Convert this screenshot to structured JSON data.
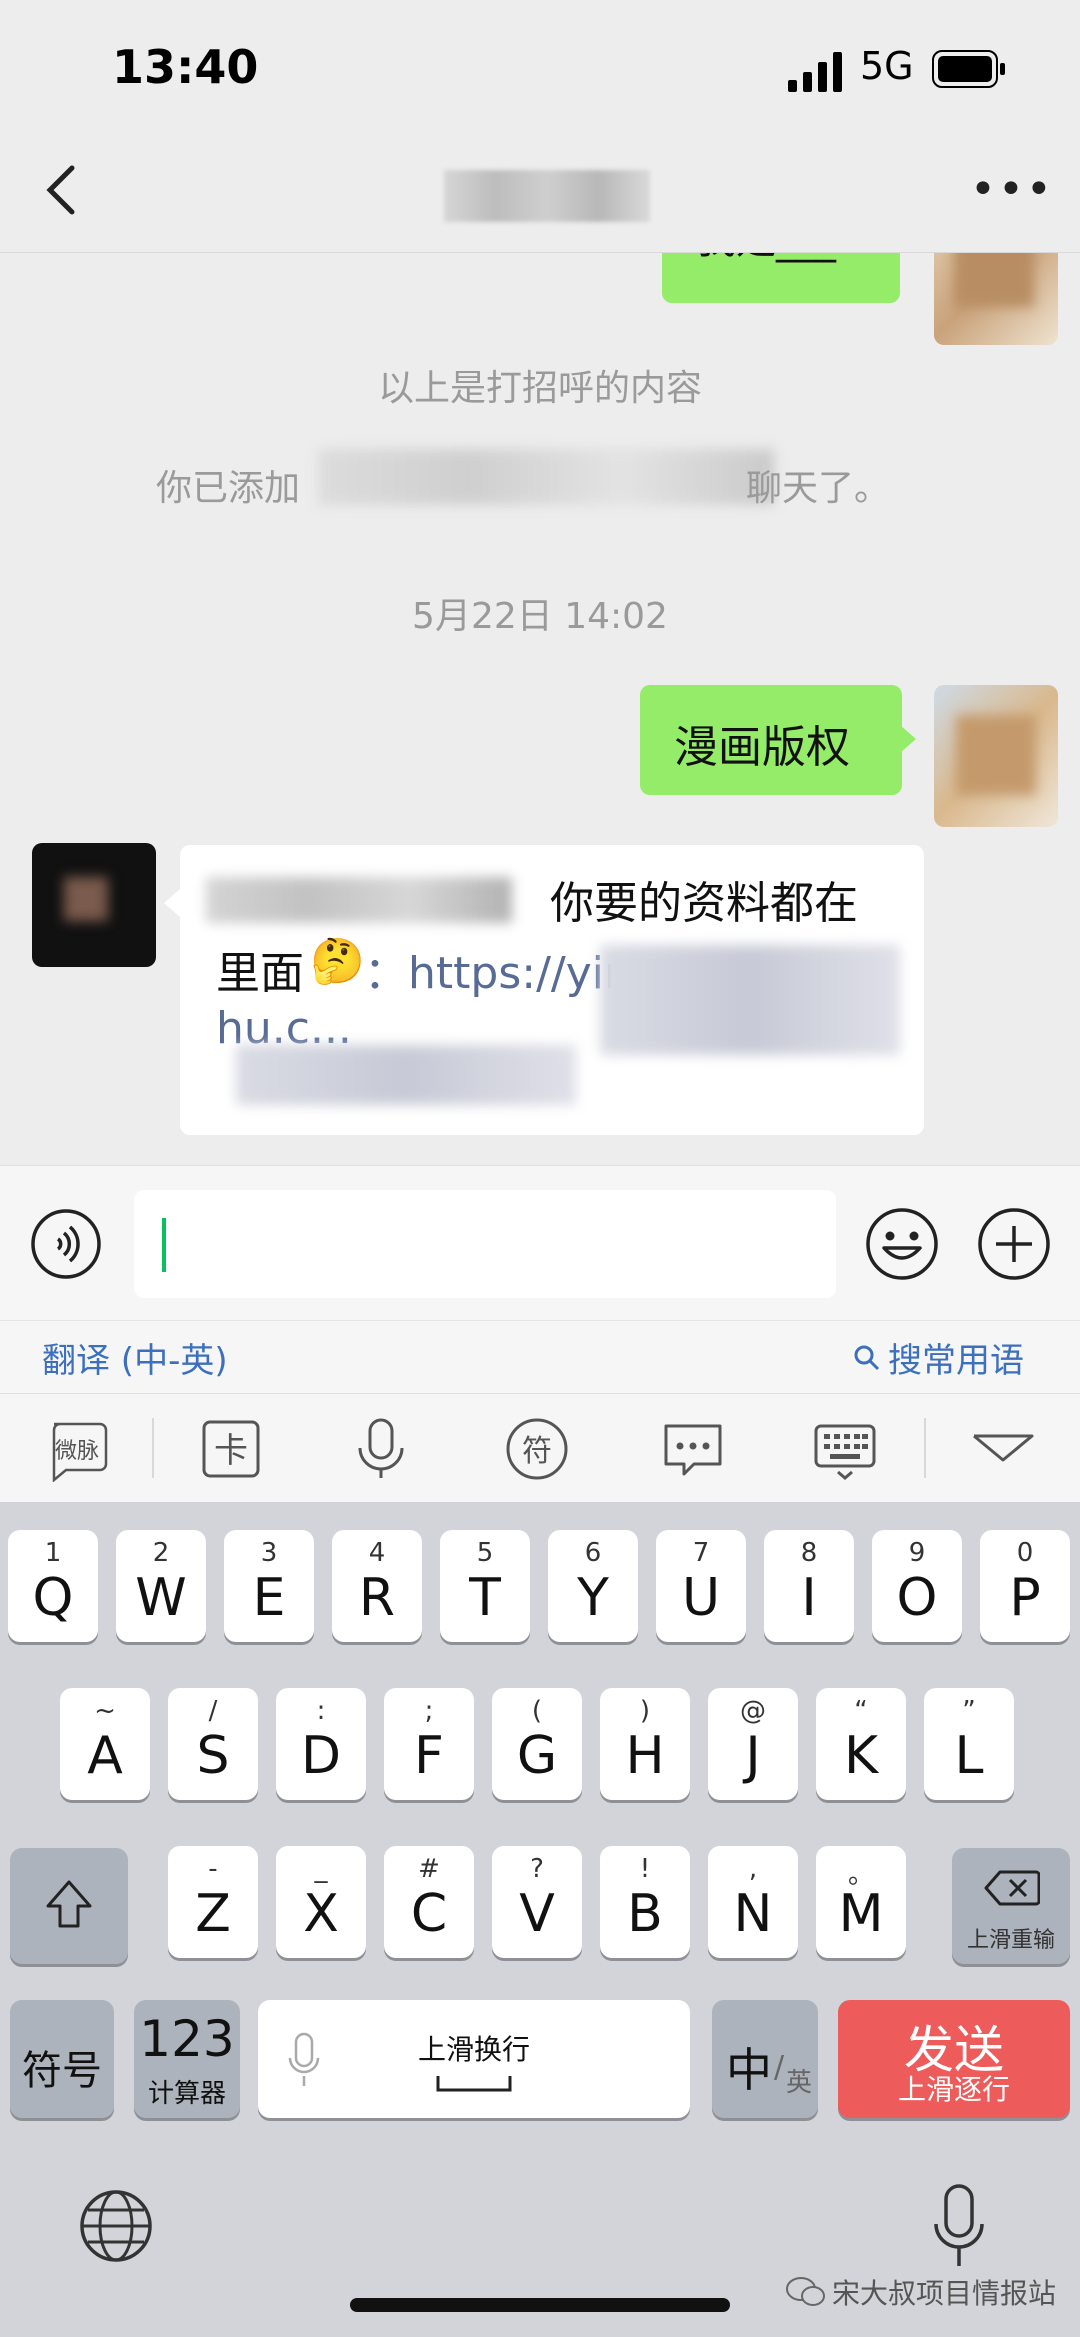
{
  "status": {
    "time": "13:40",
    "network": "5G"
  },
  "nav": {
    "title": ""
  },
  "chat": {
    "msg_top_partial": "我是___",
    "sys_greeting": "以上是打招呼的内容",
    "sys_added_prefix": "你已添加",
    "sys_added_suffix": "聊天了。",
    "timestamp": "5月22日 14:02",
    "msg_me": "漫画版权",
    "msg_other_1": "你要的资料都在",
    "msg_other_2": "里面",
    "msg_other_emoji": "🤔",
    "msg_other_url": "：https://yir",
    "msg_other_url2": "hu.c..."
  },
  "translate": {
    "label": "翻译 (中-英)",
    "phrases": "搜常用语"
  },
  "keyboard": {
    "row1": [
      {
        "k": "Q",
        "s": "1"
      },
      {
        "k": "W",
        "s": "2"
      },
      {
        "k": "E",
        "s": "3"
      },
      {
        "k": "R",
        "s": "4"
      },
      {
        "k": "T",
        "s": "5"
      },
      {
        "k": "Y",
        "s": "6"
      },
      {
        "k": "U",
        "s": "7"
      },
      {
        "k": "I",
        "s": "8"
      },
      {
        "k": "O",
        "s": "9"
      },
      {
        "k": "P",
        "s": "0"
      }
    ],
    "row2": [
      {
        "k": "A",
        "s": "~"
      },
      {
        "k": "S",
        "s": "/"
      },
      {
        "k": "D",
        "s": ":"
      },
      {
        "k": "F",
        "s": ";"
      },
      {
        "k": "G",
        "s": "("
      },
      {
        "k": "H",
        "s": ")"
      },
      {
        "k": "J",
        "s": "@"
      },
      {
        "k": "K",
        "s": "“"
      },
      {
        "k": "L",
        "s": "”"
      }
    ],
    "row3": [
      {
        "k": "Z",
        "s": "-"
      },
      {
        "k": "X",
        "s": "_"
      },
      {
        "k": "C",
        "s": "#"
      },
      {
        "k": "V",
        "s": "?"
      },
      {
        "k": "B",
        "s": "!"
      },
      {
        "k": "N",
        "s": ","
      },
      {
        "k": "M",
        "s": "。"
      }
    ],
    "backspace_hint": "上滑重输",
    "symbols": "符号",
    "num_main": "123",
    "num_sub": "计算器",
    "space_hint": "上滑换行",
    "lang_main": "中",
    "lang_sub": "英",
    "send_main": "发送",
    "send_sub": "上滑逐行"
  },
  "watermark": "宋大叔项目情报站"
}
